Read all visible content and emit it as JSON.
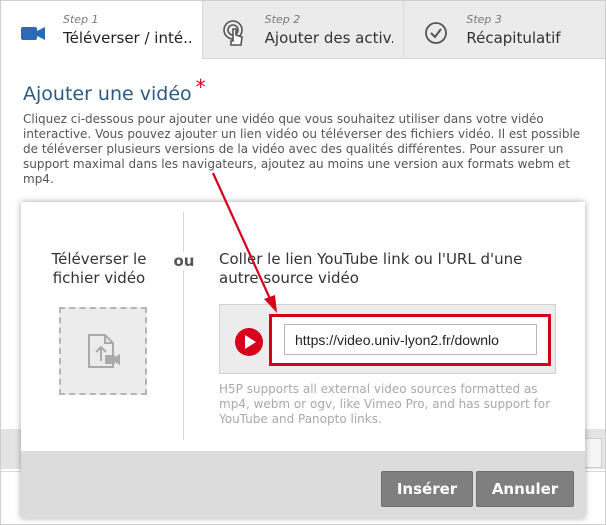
{
  "steps": [
    {
      "num": "Step 1",
      "label": "Téléverser / inté...",
      "icon": "video-camera-icon",
      "active": true
    },
    {
      "num": "Step 2",
      "label": "Ajouter des activ...",
      "icon": "touch-icon",
      "active": false
    },
    {
      "num": "Step 3",
      "label": "Récapitulatif",
      "icon": "check-circle-icon",
      "active": false
    }
  ],
  "section": {
    "title": "Ajouter une vidéo",
    "required_mark": "*",
    "description": "Cliquez ci-dessous pour ajouter une vidéo que vous souhaitez utiliser dans votre vidéo interactive. Vous pouvez ajouter un lien vidéo ou téléverser des fichiers vidéo. Il est possible de téléverser plusieurs versions de la vidéo avec des qualités différentes. Pour assurer un support maximal dans les navigateurs, ajoutez au moins une version aux formats webm et mp4."
  },
  "modal": {
    "upload_label": "Téléverser le fichier vidéo",
    "or_label": "ou",
    "paste_label": "Coller le lien YouTube link ou l'URL d'une autre source vidéo",
    "url_value": "https://video.univ-lyon2.fr/downlo",
    "hint": "H5P supports all external video sources formatted as mp4, webm or ogv, like Vimeo Pro, and has support for YouTube and Panopto links.",
    "insert_label": "Insérer",
    "cancel_label": "Annuler"
  },
  "colors": {
    "accent_blue": "#2b5a85",
    "annotation_red": "#d6001c",
    "button_grey": "#7f7f7f"
  }
}
